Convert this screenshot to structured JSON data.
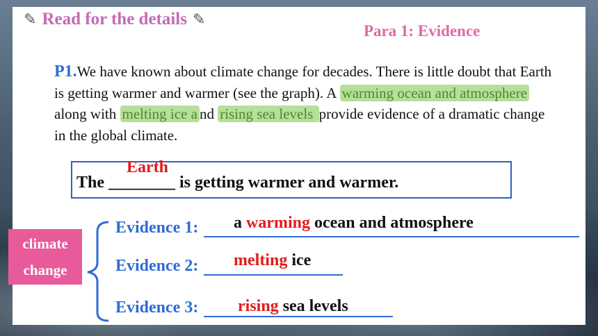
{
  "header": {
    "title": "Read for the details",
    "icon": "pencil-icon",
    "icon_glyph": "✎",
    "section_tag": "Para 1: Evidence"
  },
  "paragraph": {
    "label": "P1.",
    "text_1": "We have known about climate change for decades. There is little doubt that Earth is getting warmer and warmer (see the graph). A ",
    "highlight_1": "warming ocean and atmosphere ",
    "text_2": "along with ",
    "highlight_2": "melting ice a",
    "text_3": "nd ",
    "highlight_3": "rising sea levels ",
    "text_4": "provide evidence of a dramatic change in the global climate."
  },
  "summary": {
    "prefix": "The ",
    "blank": "________",
    "suffix": " is getting warmer and warmer.",
    "answer": "Earth"
  },
  "topic_box": {
    "line_1": "climate",
    "line_2": "change"
  },
  "evidence": [
    {
      "label": "Evidence 1:",
      "answer_pre": "a ",
      "answer_key": "warming",
      "answer_post": " ocean and atmosphere"
    },
    {
      "label": "Evidence 2:",
      "answer_pre": "",
      "answer_key": "melting",
      "answer_post": " ice"
    },
    {
      "label": "Evidence 3:",
      "answer_pre": "",
      "answer_key": "rising",
      "answer_post": " sea levels"
    }
  ],
  "colors": {
    "heading": "#c56bb7",
    "section_tag": "#e06aa3",
    "label_blue": "#2e6bd4",
    "highlight_green": "#b6df9a",
    "answer_red": "#e21c1c",
    "topic_pink": "#e85a9a"
  }
}
